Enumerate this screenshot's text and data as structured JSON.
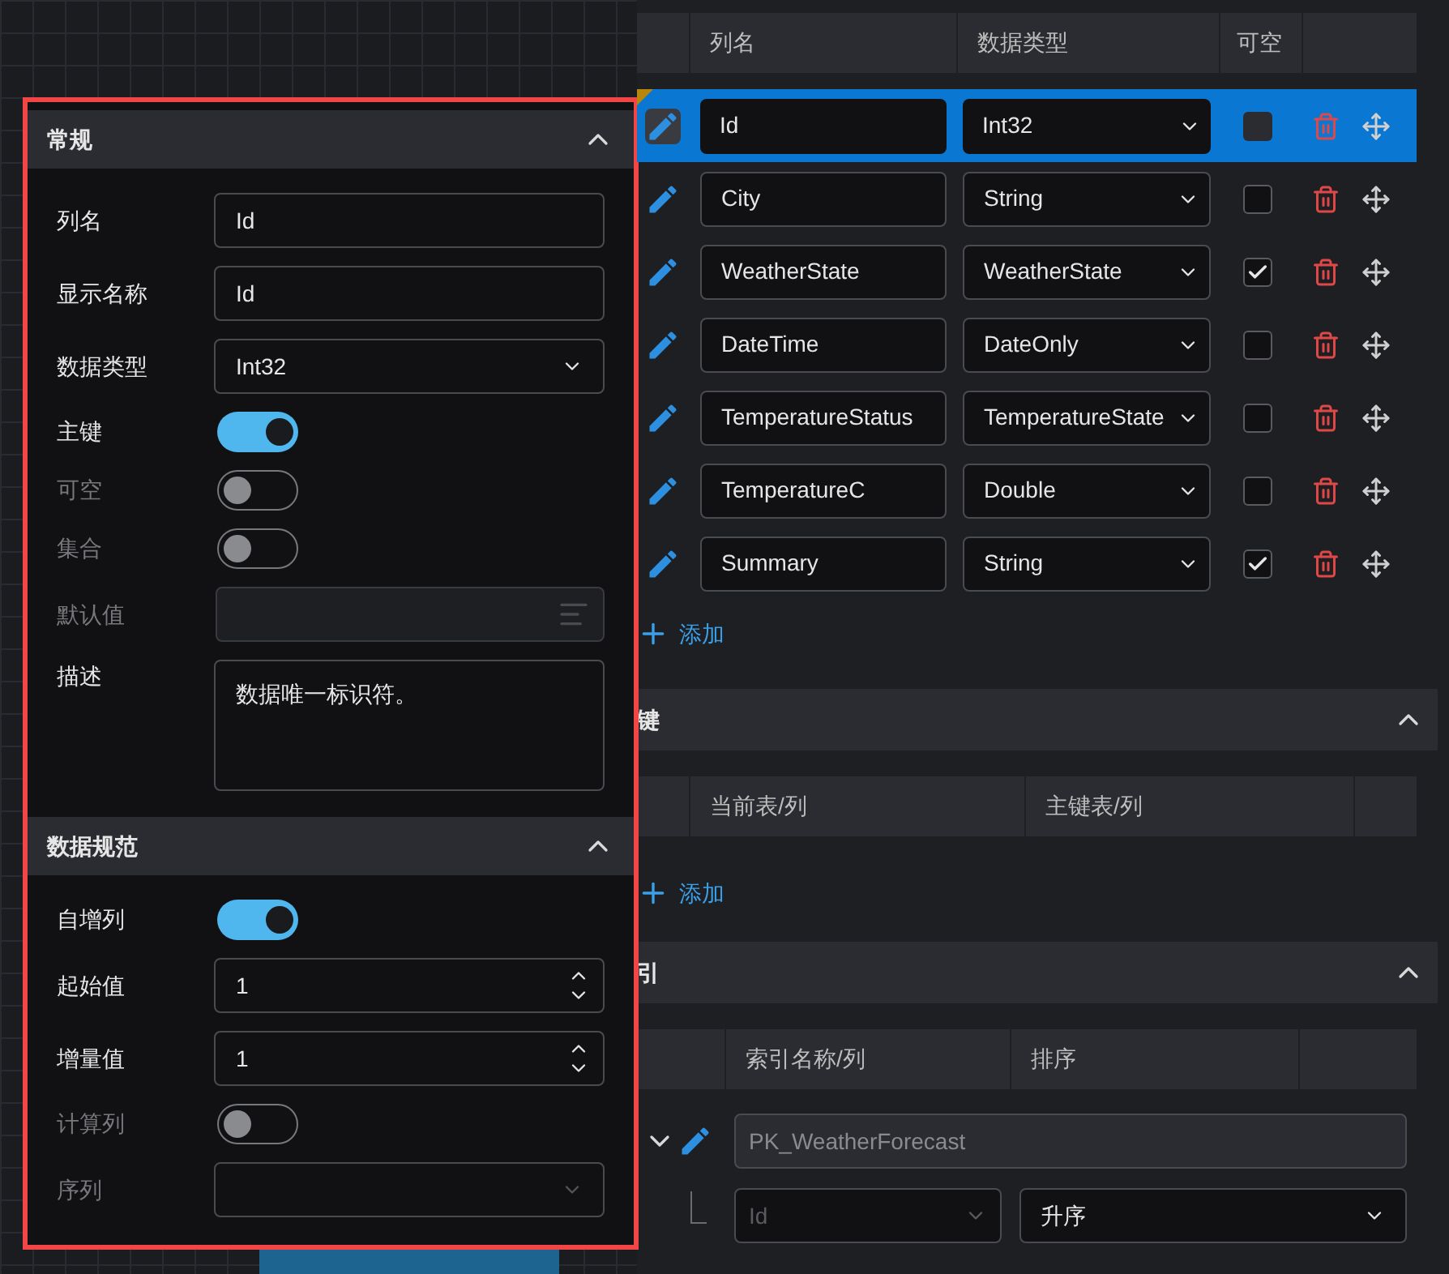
{
  "properties_popup": {
    "sections": [
      {
        "title": "常规",
        "expanded": true,
        "fields": [
          {
            "kind": "text",
            "label": "列名",
            "value": "Id",
            "disabled": false
          },
          {
            "kind": "text",
            "label": "显示名称",
            "value": "Id",
            "disabled": false
          },
          {
            "kind": "select",
            "label": "数据类型",
            "value": "Int32",
            "disabled": false
          },
          {
            "kind": "toggle",
            "label": "主键",
            "on": true,
            "disabled": false
          },
          {
            "kind": "toggle",
            "label": "可空",
            "on": false,
            "disabled": true
          },
          {
            "kind": "toggle",
            "label": "集合",
            "on": false,
            "disabled": true
          },
          {
            "kind": "picker",
            "label": "默认值",
            "disabled": true
          },
          {
            "kind": "textarea",
            "label": "描述",
            "value": "数据唯一标识符。",
            "disabled": false
          }
        ]
      },
      {
        "title": "数据规范",
        "expanded": true,
        "fields": [
          {
            "kind": "toggle",
            "label": "自增列",
            "on": true,
            "disabled": false
          },
          {
            "kind": "number",
            "label": "起始值",
            "value": "1",
            "disabled": false
          },
          {
            "kind": "number",
            "label": "增量值",
            "value": "1",
            "disabled": false
          },
          {
            "kind": "toggle",
            "label": "计算列",
            "on": false,
            "disabled": true
          },
          {
            "kind": "select",
            "label": "序列",
            "disabled": true
          }
        ]
      }
    ]
  },
  "columns_table": {
    "headers": [
      "列名",
      "数据类型",
      "可空"
    ],
    "rows": [
      {
        "name": "Id",
        "type": "Int32",
        "nullable": false,
        "selected": true,
        "primary_key": true
      },
      {
        "name": "City",
        "type": "String",
        "nullable": false,
        "selected": false,
        "primary_key": false
      },
      {
        "name": "WeatherState",
        "type": "WeatherState",
        "nullable": true,
        "selected": false,
        "primary_key": false
      },
      {
        "name": "DateTime",
        "type": "DateOnly",
        "nullable": false,
        "selected": false,
        "primary_key": false
      },
      {
        "name": "TemperatureStatus",
        "type": "TemperatureState",
        "nullable": false,
        "selected": false,
        "primary_key": false
      },
      {
        "name": "TemperatureC",
        "type": "Double",
        "nullable": false,
        "selected": false,
        "primary_key": false
      },
      {
        "name": "Summary",
        "type": "String",
        "nullable": true,
        "selected": false,
        "primary_key": false
      }
    ],
    "add_label": "添加"
  },
  "foreign_keys": {
    "title": "键",
    "expanded": true,
    "headers": [
      "当前表/列",
      "主键表/列"
    ],
    "add_label": "添加"
  },
  "indexes": {
    "title": "引",
    "expanded": true,
    "headers": [
      "索引名称/列",
      "排序"
    ],
    "rows": [
      {
        "name": "PK_WeatherForecast",
        "expanded": true,
        "columns": [
          {
            "column": "Id",
            "order": "升序"
          }
        ]
      }
    ]
  }
}
